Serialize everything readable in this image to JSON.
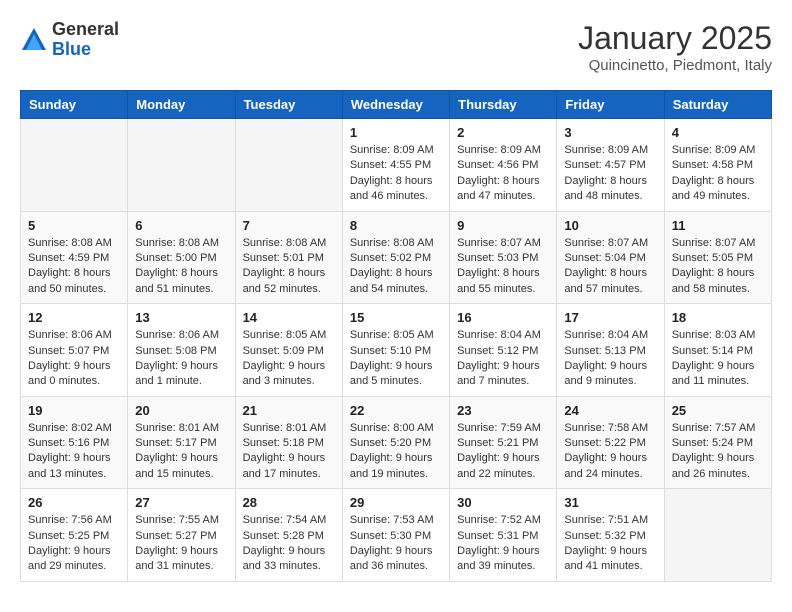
{
  "logo": {
    "general": "General",
    "blue": "Blue"
  },
  "title": "January 2025",
  "location": "Quincinetto, Piedmont, Italy",
  "weekdays": [
    "Sunday",
    "Monday",
    "Tuesday",
    "Wednesday",
    "Thursday",
    "Friday",
    "Saturday"
  ],
  "weeks": [
    [
      {
        "day": "",
        "info": ""
      },
      {
        "day": "",
        "info": ""
      },
      {
        "day": "",
        "info": ""
      },
      {
        "day": "1",
        "info": "Sunrise: 8:09 AM\nSunset: 4:55 PM\nDaylight: 8 hours and 46 minutes."
      },
      {
        "day": "2",
        "info": "Sunrise: 8:09 AM\nSunset: 4:56 PM\nDaylight: 8 hours and 47 minutes."
      },
      {
        "day": "3",
        "info": "Sunrise: 8:09 AM\nSunset: 4:57 PM\nDaylight: 8 hours and 48 minutes."
      },
      {
        "day": "4",
        "info": "Sunrise: 8:09 AM\nSunset: 4:58 PM\nDaylight: 8 hours and 49 minutes."
      }
    ],
    [
      {
        "day": "5",
        "info": "Sunrise: 8:08 AM\nSunset: 4:59 PM\nDaylight: 8 hours and 50 minutes."
      },
      {
        "day": "6",
        "info": "Sunrise: 8:08 AM\nSunset: 5:00 PM\nDaylight: 8 hours and 51 minutes."
      },
      {
        "day": "7",
        "info": "Sunrise: 8:08 AM\nSunset: 5:01 PM\nDaylight: 8 hours and 52 minutes."
      },
      {
        "day": "8",
        "info": "Sunrise: 8:08 AM\nSunset: 5:02 PM\nDaylight: 8 hours and 54 minutes."
      },
      {
        "day": "9",
        "info": "Sunrise: 8:07 AM\nSunset: 5:03 PM\nDaylight: 8 hours and 55 minutes."
      },
      {
        "day": "10",
        "info": "Sunrise: 8:07 AM\nSunset: 5:04 PM\nDaylight: 8 hours and 57 minutes."
      },
      {
        "day": "11",
        "info": "Sunrise: 8:07 AM\nSunset: 5:05 PM\nDaylight: 8 hours and 58 minutes."
      }
    ],
    [
      {
        "day": "12",
        "info": "Sunrise: 8:06 AM\nSunset: 5:07 PM\nDaylight: 9 hours and 0 minutes."
      },
      {
        "day": "13",
        "info": "Sunrise: 8:06 AM\nSunset: 5:08 PM\nDaylight: 9 hours and 1 minute."
      },
      {
        "day": "14",
        "info": "Sunrise: 8:05 AM\nSunset: 5:09 PM\nDaylight: 9 hours and 3 minutes."
      },
      {
        "day": "15",
        "info": "Sunrise: 8:05 AM\nSunset: 5:10 PM\nDaylight: 9 hours and 5 minutes."
      },
      {
        "day": "16",
        "info": "Sunrise: 8:04 AM\nSunset: 5:12 PM\nDaylight: 9 hours and 7 minutes."
      },
      {
        "day": "17",
        "info": "Sunrise: 8:04 AM\nSunset: 5:13 PM\nDaylight: 9 hours and 9 minutes."
      },
      {
        "day": "18",
        "info": "Sunrise: 8:03 AM\nSunset: 5:14 PM\nDaylight: 9 hours and 11 minutes."
      }
    ],
    [
      {
        "day": "19",
        "info": "Sunrise: 8:02 AM\nSunset: 5:16 PM\nDaylight: 9 hours and 13 minutes."
      },
      {
        "day": "20",
        "info": "Sunrise: 8:01 AM\nSunset: 5:17 PM\nDaylight: 9 hours and 15 minutes."
      },
      {
        "day": "21",
        "info": "Sunrise: 8:01 AM\nSunset: 5:18 PM\nDaylight: 9 hours and 17 minutes."
      },
      {
        "day": "22",
        "info": "Sunrise: 8:00 AM\nSunset: 5:20 PM\nDaylight: 9 hours and 19 minutes."
      },
      {
        "day": "23",
        "info": "Sunrise: 7:59 AM\nSunset: 5:21 PM\nDaylight: 9 hours and 22 minutes."
      },
      {
        "day": "24",
        "info": "Sunrise: 7:58 AM\nSunset: 5:22 PM\nDaylight: 9 hours and 24 minutes."
      },
      {
        "day": "25",
        "info": "Sunrise: 7:57 AM\nSunset: 5:24 PM\nDaylight: 9 hours and 26 minutes."
      }
    ],
    [
      {
        "day": "26",
        "info": "Sunrise: 7:56 AM\nSunset: 5:25 PM\nDaylight: 9 hours and 29 minutes."
      },
      {
        "day": "27",
        "info": "Sunrise: 7:55 AM\nSunset: 5:27 PM\nDaylight: 9 hours and 31 minutes."
      },
      {
        "day": "28",
        "info": "Sunrise: 7:54 AM\nSunset: 5:28 PM\nDaylight: 9 hours and 33 minutes."
      },
      {
        "day": "29",
        "info": "Sunrise: 7:53 AM\nSunset: 5:30 PM\nDaylight: 9 hours and 36 minutes."
      },
      {
        "day": "30",
        "info": "Sunrise: 7:52 AM\nSunset: 5:31 PM\nDaylight: 9 hours and 39 minutes."
      },
      {
        "day": "31",
        "info": "Sunrise: 7:51 AM\nSunset: 5:32 PM\nDaylight: 9 hours and 41 minutes."
      },
      {
        "day": "",
        "info": ""
      }
    ]
  ]
}
